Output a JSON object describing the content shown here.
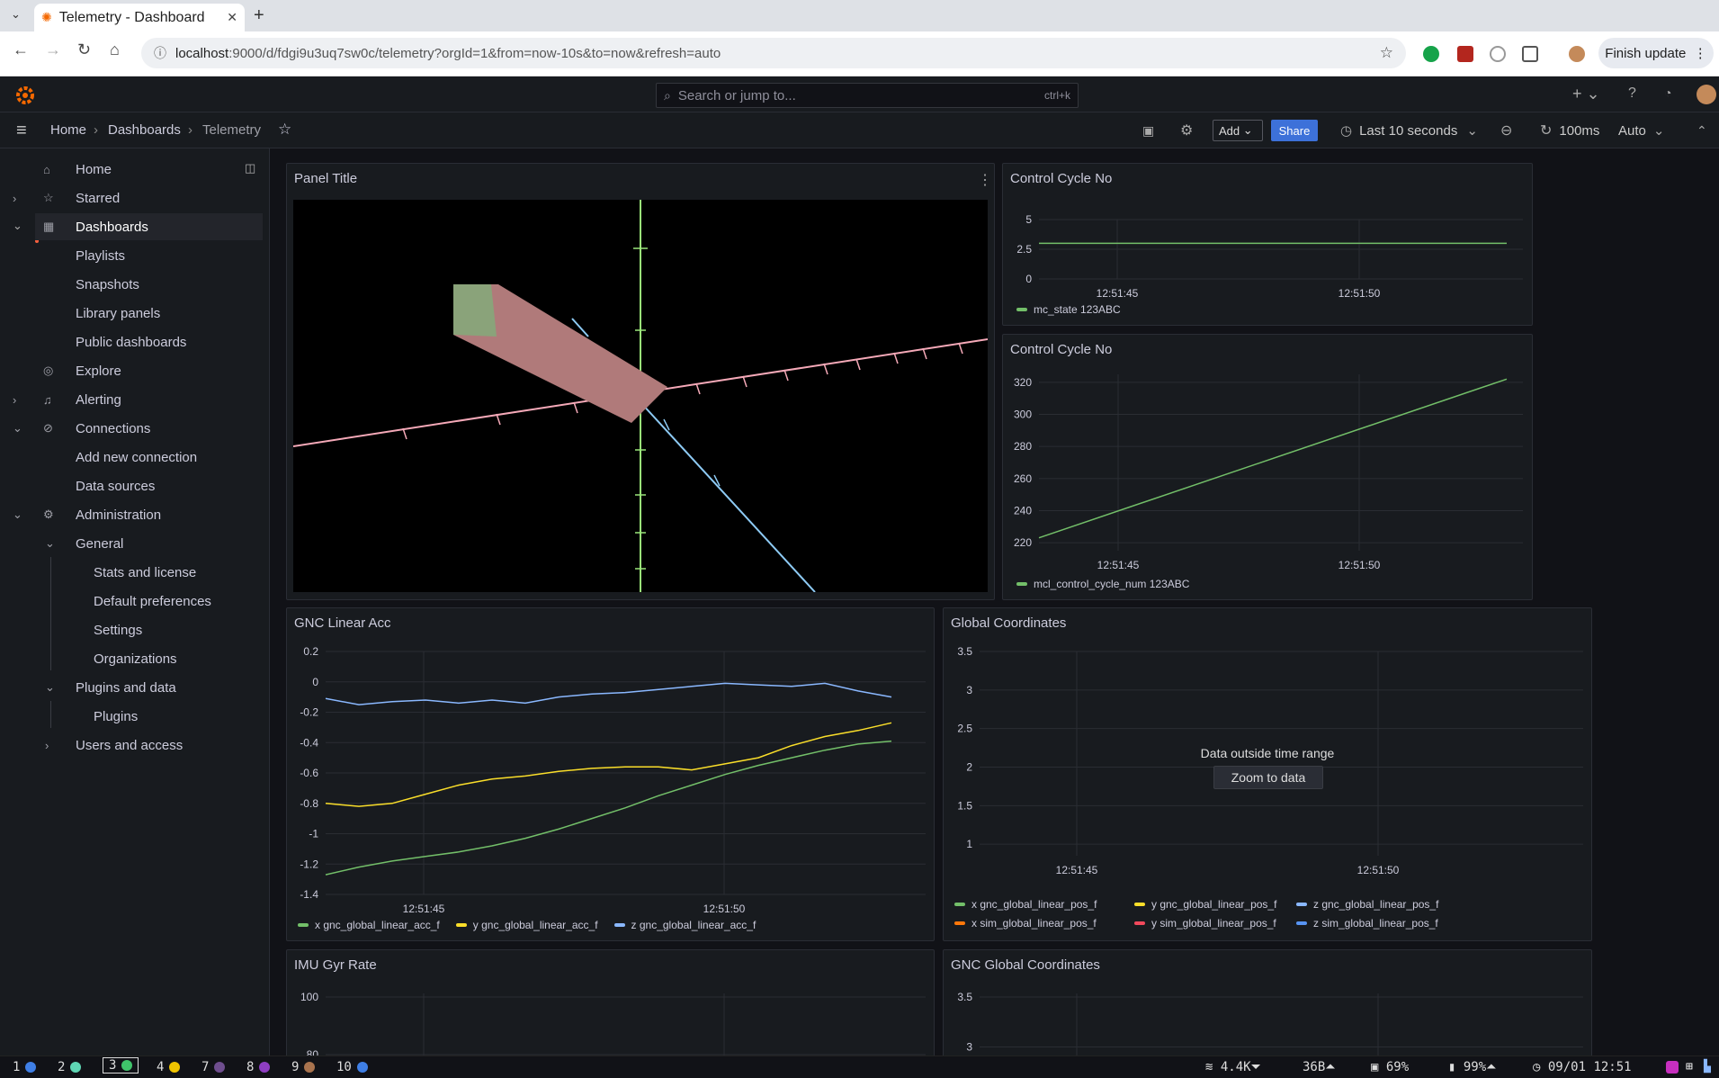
{
  "browser": {
    "tab_title": "Telemetry - Dashboard",
    "url_host": "localhost",
    "url_rest": ":9000/d/fdgi9u3uq7sw0c/telemetry?orgId=1&from=now-10s&to=now&refresh=auto",
    "finish_update": "Finish update"
  },
  "topbar": {
    "search_placeholder": "Search or jump to...",
    "search_shortcut": "ctrl+k"
  },
  "breadcrumb": {
    "home": "Home",
    "dashboards": "Dashboards",
    "current": "Telemetry"
  },
  "toolbar": {
    "add": "Add",
    "share": "Share",
    "time_range": "Last 10 seconds",
    "refresh_interval": "100ms",
    "refresh_mode": "Auto"
  },
  "sidebar": {
    "items": [
      {
        "label": "Home"
      },
      {
        "label": "Starred"
      },
      {
        "label": "Dashboards"
      },
      {
        "label": "Playlists"
      },
      {
        "label": "Snapshots"
      },
      {
        "label": "Library panels"
      },
      {
        "label": "Public dashboards"
      },
      {
        "label": "Explore"
      },
      {
        "label": "Alerting"
      },
      {
        "label": "Connections"
      },
      {
        "label": "Add new connection"
      },
      {
        "label": "Data sources"
      },
      {
        "label": "Administration"
      },
      {
        "label": "General"
      },
      {
        "label": "Stats and license"
      },
      {
        "label": "Default preferences"
      },
      {
        "label": "Settings"
      },
      {
        "label": "Organizations"
      },
      {
        "label": "Plugins and data"
      },
      {
        "label": "Plugins"
      },
      {
        "label": "Users and access"
      }
    ]
  },
  "panels": {
    "p3d": {
      "title": "Panel Title"
    },
    "cc1": {
      "title": "Control Cycle No",
      "legend": "mc_state 123ABC"
    },
    "cc2": {
      "title": "Control Cycle No",
      "legend": "mcl_control_cycle_num 123ABC"
    },
    "gla": {
      "title": "GNC Linear Acc",
      "legend": [
        "x gnc_global_linear_acc_f",
        "y gnc_global_linear_acc_f",
        "z gnc_global_linear_acc_f"
      ]
    },
    "gc": {
      "title": "Global Coordinates",
      "message": "Data outside time range",
      "zoom_button": "Zoom to data",
      "legend": [
        "x gnc_global_linear_pos_f",
        "y gnc_global_linear_pos_f",
        "z gnc_global_linear_pos_f",
        "x sim_global_linear_pos_f",
        "y sim_global_linear_pos_f",
        "z sim_global_linear_pos_f"
      ]
    },
    "imu": {
      "title": "IMU Gyr Rate"
    },
    "ggc": {
      "title": "GNC Global Coordinates"
    }
  },
  "chart_data": [
    {
      "type": "line",
      "title": "Control Cycle No",
      "x_ticks": [
        "12:51:45",
        "12:51:50"
      ],
      "y_ticks": [
        "5",
        "2.5",
        "0"
      ],
      "ylim": [
        0,
        5
      ],
      "series": [
        {
          "name": "mc_state 123ABC",
          "color": "#73bf69",
          "values": [
            3,
            3
          ]
        }
      ]
    },
    {
      "type": "line",
      "title": "Control Cycle No",
      "x_ticks": [
        "12:51:45",
        "12:51:50"
      ],
      "y_ticks": [
        "320",
        "300",
        "280",
        "260",
        "240",
        "220"
      ],
      "ylim": [
        215,
        325
      ],
      "series": [
        {
          "name": "mcl_control_cycle_num 123ABC",
          "color": "#73bf69",
          "values": [
            223,
            322
          ]
        }
      ]
    },
    {
      "type": "line",
      "title": "GNC Linear Acc",
      "x_ticks": [
        "12:51:45",
        "12:51:50"
      ],
      "y_ticks": [
        "0.2",
        "0",
        "-0.2",
        "-0.4",
        "-0.6",
        "-0.8",
        "-1",
        "-1.2",
        "-1.4"
      ],
      "ylim": [
        -1.4,
        0.2
      ],
      "series": [
        {
          "name": "x gnc_global_linear_acc_f",
          "color": "#73bf69",
          "values": [
            -1.27,
            -1.22,
            -1.18,
            -1.15,
            -1.12,
            -1.08,
            -1.03,
            -0.97,
            -0.9,
            -0.83,
            -0.75,
            -0.68,
            -0.61,
            -0.55,
            -0.5,
            -0.45,
            -0.41,
            -0.39
          ]
        },
        {
          "name": "y gnc_global_linear_acc_f",
          "color": "#fade2a",
          "values": [
            -0.8,
            -0.82,
            -0.8,
            -0.74,
            -0.68,
            -0.64,
            -0.62,
            -0.59,
            -0.57,
            -0.56,
            -0.56,
            -0.58,
            -0.54,
            -0.5,
            -0.42,
            -0.36,
            -0.32,
            -0.27
          ]
        },
        {
          "name": "z gnc_global_linear_acc_f",
          "color": "#8ab8ff",
          "values": [
            -0.11,
            -0.15,
            -0.13,
            -0.12,
            -0.14,
            -0.12,
            -0.14,
            -0.1,
            -0.08,
            -0.07,
            -0.05,
            -0.03,
            -0.01,
            -0.02,
            -0.03,
            -0.01,
            -0.06,
            -0.1
          ]
        }
      ]
    },
    {
      "type": "line",
      "title": "Global Coordinates",
      "x_ticks": [
        "12:51:45",
        "12:51:50"
      ],
      "y_ticks": [
        "3.5",
        "3",
        "2.5",
        "2",
        "1.5",
        "1"
      ],
      "ylim": [
        0.85,
        3.5
      ],
      "series": []
    },
    {
      "type": "line",
      "title": "IMU Gyr Rate",
      "y_ticks": [
        "100",
        "80"
      ],
      "series": []
    },
    {
      "type": "line",
      "title": "GNC Global Coordinates",
      "y_ticks": [
        "3.5",
        "3"
      ],
      "series": []
    }
  ],
  "statusbar": {
    "workspaces": [
      {
        "num": "1",
        "color": "#3f7fe6"
      },
      {
        "num": "2",
        "color": "#5fd6b4"
      },
      {
        "num": "3",
        "color": "#3fc46a"
      },
      {
        "num": "4",
        "color": "#f0c400"
      },
      {
        "num": "7",
        "color": "#6f4e8f"
      },
      {
        "num": "8",
        "color": "#8f3ec2"
      },
      {
        "num": "9",
        "color": "#a9734e"
      },
      {
        "num": "10",
        "color": "#3f7fe6"
      }
    ],
    "net": "4.4K",
    "disk": "36B",
    "cpu": "69%",
    "battery": "99%",
    "datetime": "09/01 12:51"
  }
}
